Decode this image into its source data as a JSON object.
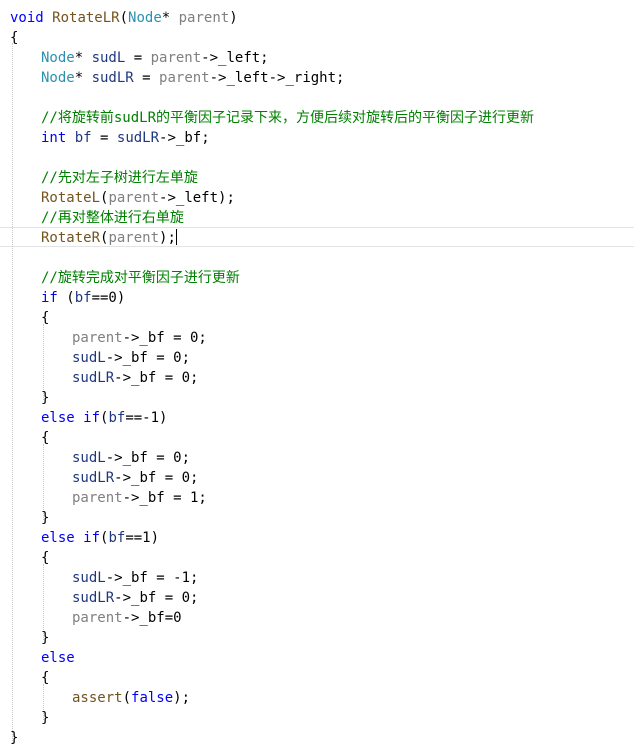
{
  "editor": {
    "lines": [
      [
        {
          "t": "void",
          "c": "kw"
        },
        {
          "t": " "
        },
        {
          "t": "RotateLR",
          "c": "fn"
        },
        {
          "t": "("
        },
        {
          "t": "Node",
          "c": "tp"
        },
        {
          "t": "* "
        },
        {
          "t": "parent",
          "c": "pm"
        },
        {
          "t": ")"
        }
      ],
      [
        {
          "t": "{"
        }
      ],
      [
        {
          "t": "Node",
          "c": "tp"
        },
        {
          "t": "* "
        },
        {
          "t": "sudL",
          "c": "lv"
        },
        {
          "t": " = "
        },
        {
          "t": "parent",
          "c": "pm"
        },
        {
          "t": "->_left;"
        }
      ],
      [
        {
          "t": "Node",
          "c": "tp"
        },
        {
          "t": "* "
        },
        {
          "t": "sudLR",
          "c": "lv"
        },
        {
          "t": " = "
        },
        {
          "t": "parent",
          "c": "pm"
        },
        {
          "t": "->_left->_right;"
        }
      ],
      [],
      [
        {
          "t": "//将旋转前sudLR的平衡因子记录下来，方便后续对旋转后的平衡因子进行更新",
          "c": "cm"
        }
      ],
      [
        {
          "t": "int",
          "c": "kw"
        },
        {
          "t": " "
        },
        {
          "t": "bf",
          "c": "lv"
        },
        {
          "t": " = "
        },
        {
          "t": "sudLR",
          "c": "lv"
        },
        {
          "t": "->_bf;"
        }
      ],
      [],
      [
        {
          "t": "//先对左子树进行左单旋",
          "c": "cm"
        }
      ],
      [
        {
          "t": "RotateL",
          "c": "fn"
        },
        {
          "t": "("
        },
        {
          "t": "parent",
          "c": "pm"
        },
        {
          "t": "->_left);"
        }
      ],
      [
        {
          "t": "//再对整体进行右单旋",
          "c": "cm"
        }
      ],
      [
        {
          "t": "RotateR",
          "c": "fn"
        },
        {
          "t": "("
        },
        {
          "t": "parent",
          "c": "pm"
        },
        {
          "t": ");"
        }
      ],
      [],
      [
        {
          "t": "//旋转完成对平衡因子进行更新",
          "c": "cm"
        }
      ],
      [
        {
          "t": "if",
          "c": "kw"
        },
        {
          "t": " ("
        },
        {
          "t": "bf",
          "c": "lv"
        },
        {
          "t": "==0)"
        }
      ],
      [
        {
          "t": "{"
        }
      ],
      [
        {
          "t": "parent",
          "c": "pm"
        },
        {
          "t": "->_bf = 0;"
        }
      ],
      [
        {
          "t": "sudL",
          "c": "lv"
        },
        {
          "t": "->_bf = 0;"
        }
      ],
      [
        {
          "t": "sudLR",
          "c": "lv"
        },
        {
          "t": "->_bf = 0;"
        }
      ],
      [
        {
          "t": "}"
        }
      ],
      [
        {
          "t": "else",
          "c": "kw"
        },
        {
          "t": " "
        },
        {
          "t": "if",
          "c": "kw"
        },
        {
          "t": "("
        },
        {
          "t": "bf",
          "c": "lv"
        },
        {
          "t": "==-1)"
        }
      ],
      [
        {
          "t": "{"
        }
      ],
      [
        {
          "t": "sudL",
          "c": "lv"
        },
        {
          "t": "->_bf = 0;"
        }
      ],
      [
        {
          "t": "sudLR",
          "c": "lv"
        },
        {
          "t": "->_bf = 0;"
        }
      ],
      [
        {
          "t": "parent",
          "c": "pm"
        },
        {
          "t": "->_bf = 1;"
        }
      ],
      [
        {
          "t": "}"
        }
      ],
      [
        {
          "t": "else",
          "c": "kw"
        },
        {
          "t": " "
        },
        {
          "t": "if",
          "c": "kw"
        },
        {
          "t": "("
        },
        {
          "t": "bf",
          "c": "lv"
        },
        {
          "t": "==1)"
        }
      ],
      [
        {
          "t": "{"
        }
      ],
      [
        {
          "t": "sudL",
          "c": "lv"
        },
        {
          "t": "->_bf = -1;"
        }
      ],
      [
        {
          "t": "sudLR",
          "c": "lv"
        },
        {
          "t": "->_bf = 0;"
        }
      ],
      [
        {
          "t": "parent",
          "c": "pm"
        },
        {
          "t": "->_bf=0"
        }
      ],
      [
        {
          "t": "}"
        }
      ],
      [
        {
          "t": "else",
          "c": "kw"
        }
      ],
      [
        {
          "t": "{"
        }
      ],
      [
        {
          "t": "assert",
          "c": "fn"
        },
        {
          "t": "("
        },
        {
          "t": "false",
          "c": "kw"
        },
        {
          "t": ");"
        }
      ],
      [
        {
          "t": "}"
        }
      ],
      [
        {
          "t": "}"
        }
      ]
    ]
  },
  "colors": {
    "keyword": "#0000ff",
    "type": "#2b91af",
    "function": "#74531f",
    "parameter": "#808080",
    "local": "#1f377f",
    "comment": "#008000"
  }
}
